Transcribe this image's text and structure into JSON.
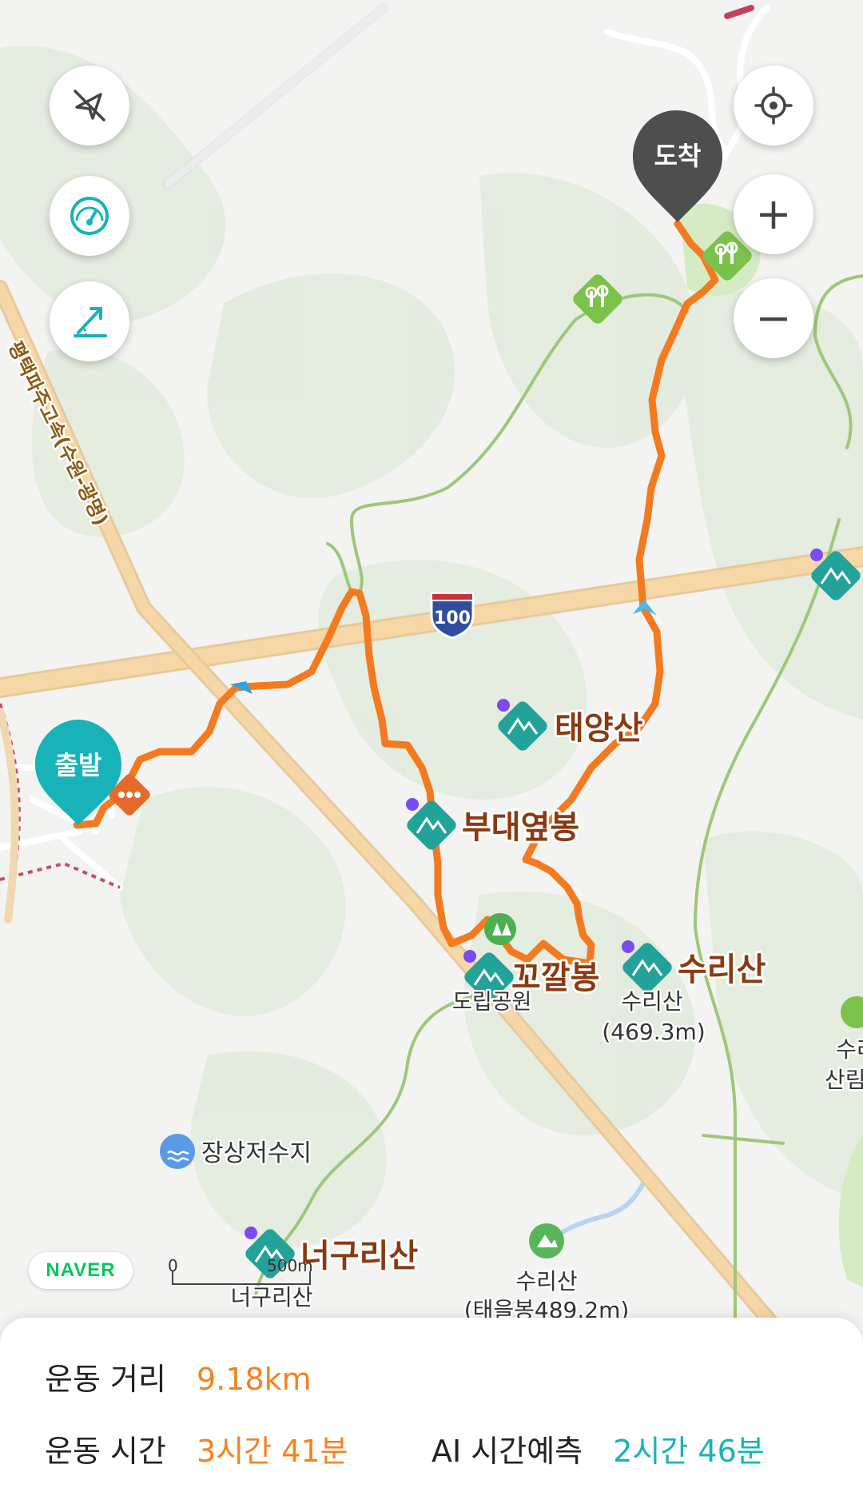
{
  "map": {
    "start_label": "출발",
    "end_label": "도착",
    "highway_shield": "100",
    "road_name": "평택파주고속(수원-광명)",
    "peaks": {
      "taeyangsan": "태양산",
      "budaeyeopbong": "부대옆봉",
      "kkokkalbong": "꼬깔봉",
      "surisan": "수리산",
      "surisan_sub": "수리산",
      "surisan_elev": "(469.3m)",
      "neogurisan": "너구리산",
      "neogurisan_sub": "너구리산",
      "surisan_tae_name": "수리산",
      "surisan_tae_elev": "(태을봉489.2m)",
      "edge_top": "수리",
      "edge_bottom": "산림"
    },
    "park_label": "도립공원",
    "reservoir_label": "장상저수지",
    "scale": {
      "zero": "0",
      "distance": "500m"
    },
    "logo": "NAVER",
    "colors": {
      "route": "#f47a20",
      "peak": "#22a49a",
      "start_pin": "#17b3b8",
      "end_pin": "#505050"
    }
  },
  "controls": {
    "compass_icon": "compass-off-icon",
    "speed_icon": "gauge-icon",
    "slope_icon": "slope-icon",
    "locate_icon": "locate-icon",
    "zoom_in": "+",
    "zoom_out": "−"
  },
  "stats": {
    "distance_label": "운동 거리",
    "distance_value": "9.18km",
    "time_label": "운동 시간",
    "time_value": "3시간 41분",
    "ai_label": "AI 시간예측",
    "ai_value": "2시간 46분"
  }
}
